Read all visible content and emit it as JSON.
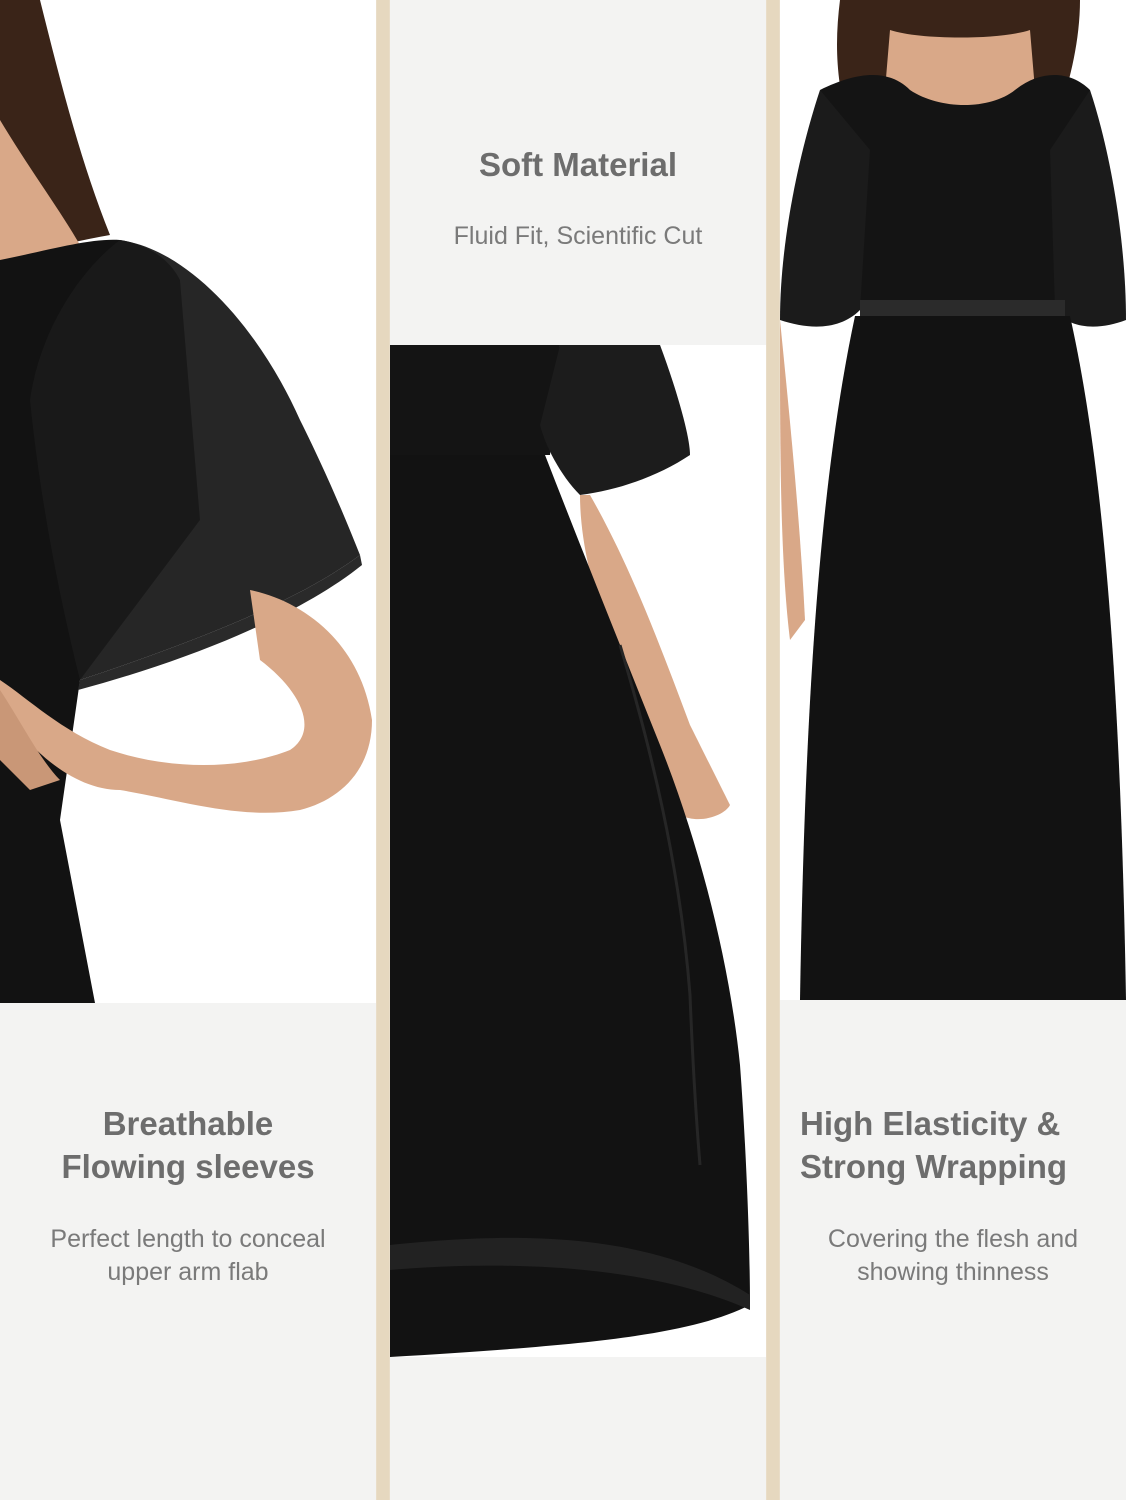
{
  "panels": [
    {
      "title": "Breathable\nFlowing sleeves",
      "subtitle": "Perfect length to conceal\nupper arm flab"
    },
    {
      "title": "Soft Material",
      "subtitle": "Fluid Fit, Scientific Cut"
    },
    {
      "title": "High Elasticity &\nStrong Wrapping",
      "subtitle": "Covering the flesh and\nshowing thinness"
    }
  ],
  "colors": {
    "divider": "#e6d8bf",
    "panel_bg": "#f3f3f2",
    "dress": "#111111",
    "skin": "#d9a888",
    "hair": "#3a2418",
    "title_text": "#6d6d6d"
  }
}
